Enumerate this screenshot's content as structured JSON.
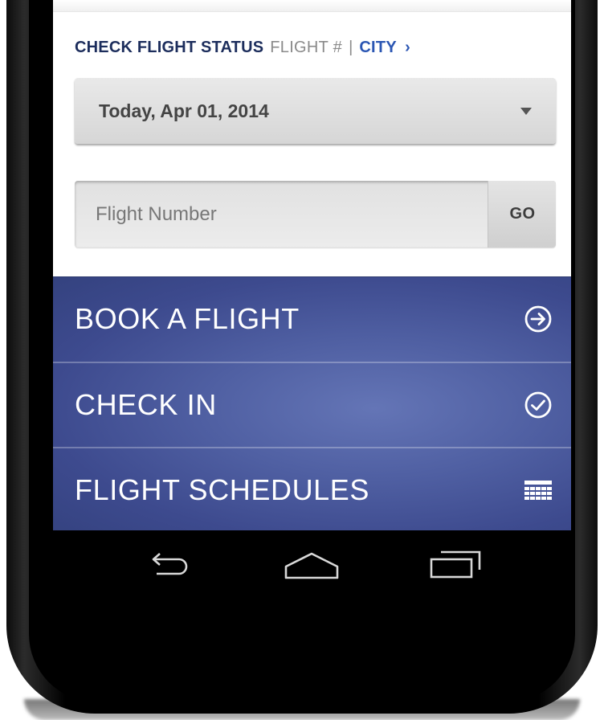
{
  "flight_status": {
    "title": "CHECK FLIGHT STATUS",
    "option_flight": "FLIGHT #",
    "divider": "|",
    "option_city": "CITY",
    "chevron": "›"
  },
  "date_select": {
    "value": "Today, Apr 01, 2014"
  },
  "flight_search": {
    "placeholder": "Flight Number",
    "go_label": "GO"
  },
  "menu": {
    "items": [
      {
        "label": "BOOK A FLIGHT",
        "icon": "arrow-circle-right-icon"
      },
      {
        "label": "CHECK IN",
        "icon": "check-circle-icon"
      },
      {
        "label": "FLIGHT SCHEDULES",
        "icon": "calendar-grid-icon"
      }
    ]
  },
  "nav": {
    "buttons": [
      "back-icon",
      "home-icon",
      "recent-apps-icon"
    ]
  },
  "colors": {
    "brand_navy": "#1c2d5c",
    "link_blue": "#2b56b3",
    "menu_blue": "#4f5fa2"
  }
}
